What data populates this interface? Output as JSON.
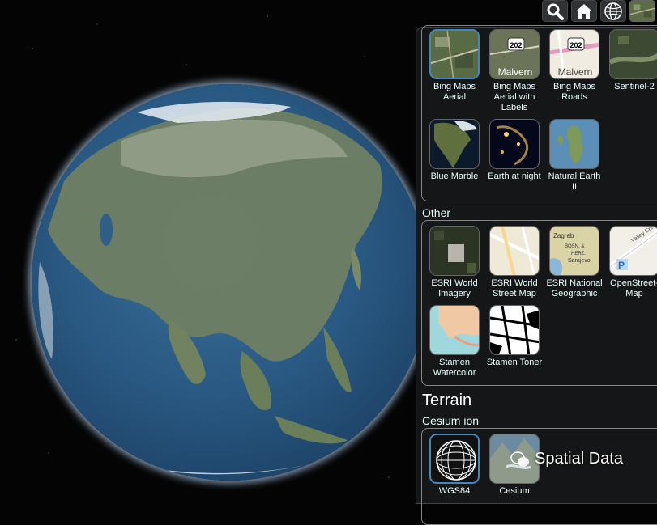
{
  "toolbar": {
    "buttons": [
      {
        "name": "search-button",
        "icon": "search-icon"
      },
      {
        "name": "home-button",
        "icon": "home-icon"
      },
      {
        "name": "scene-mode-button",
        "icon": "globe-icon"
      },
      {
        "name": "base-layer-picker-button",
        "icon": "aerial-thumbnail"
      }
    ]
  },
  "imagery": {
    "items": [
      {
        "label": "Bing Maps Aerial",
        "selected": true,
        "thumb": "aerial"
      },
      {
        "label": "Bing Maps Aerial with Labels",
        "selected": false,
        "thumb": "aerial-labels",
        "tag": "202",
        "place": "Malvern"
      },
      {
        "label": "Bing Maps Roads",
        "selected": false,
        "thumb": "roads",
        "tag": "202",
        "place": "Malvern"
      },
      {
        "label": "Sentinel-2",
        "selected": false,
        "thumb": "sentinel"
      },
      {
        "label": "Blue Marble",
        "selected": false,
        "thumb": "blue-marble"
      },
      {
        "label": "Earth at night",
        "selected": false,
        "thumb": "night"
      },
      {
        "label": "Natural Earth II",
        "selected": false,
        "thumb": "natural-earth"
      }
    ]
  },
  "other": {
    "title": "Other",
    "items": [
      {
        "label": "ESRI World Imagery",
        "thumb": "esri-imagery"
      },
      {
        "label": "ESRI World Street Map",
        "thumb": "esri-street"
      },
      {
        "label": "ESRI National Geographic",
        "thumb": "natgeo",
        "map_text": "Zagreb BOSN. & HERZ. Sarajevo"
      },
      {
        "label": "OpenStreet-Map",
        "thumb": "osm",
        "map_text": "Valley Creek Blvd"
      },
      {
        "label": "Stamen Watercolor",
        "thumb": "watercolor"
      },
      {
        "label": "Stamen Toner",
        "thumb": "toner"
      }
    ]
  },
  "terrain": {
    "title": "Terrain",
    "provider": "Cesium ion",
    "items": [
      {
        "label": "WGS84",
        "selected": true,
        "thumb": "ellipsoid"
      },
      {
        "label": "Cesium",
        "selected": false,
        "thumb": "terrain"
      }
    ]
  },
  "watermark": "Spatial Data",
  "colors": {
    "panel": "#161718",
    "accent": "#48b",
    "text": "#edffff"
  }
}
